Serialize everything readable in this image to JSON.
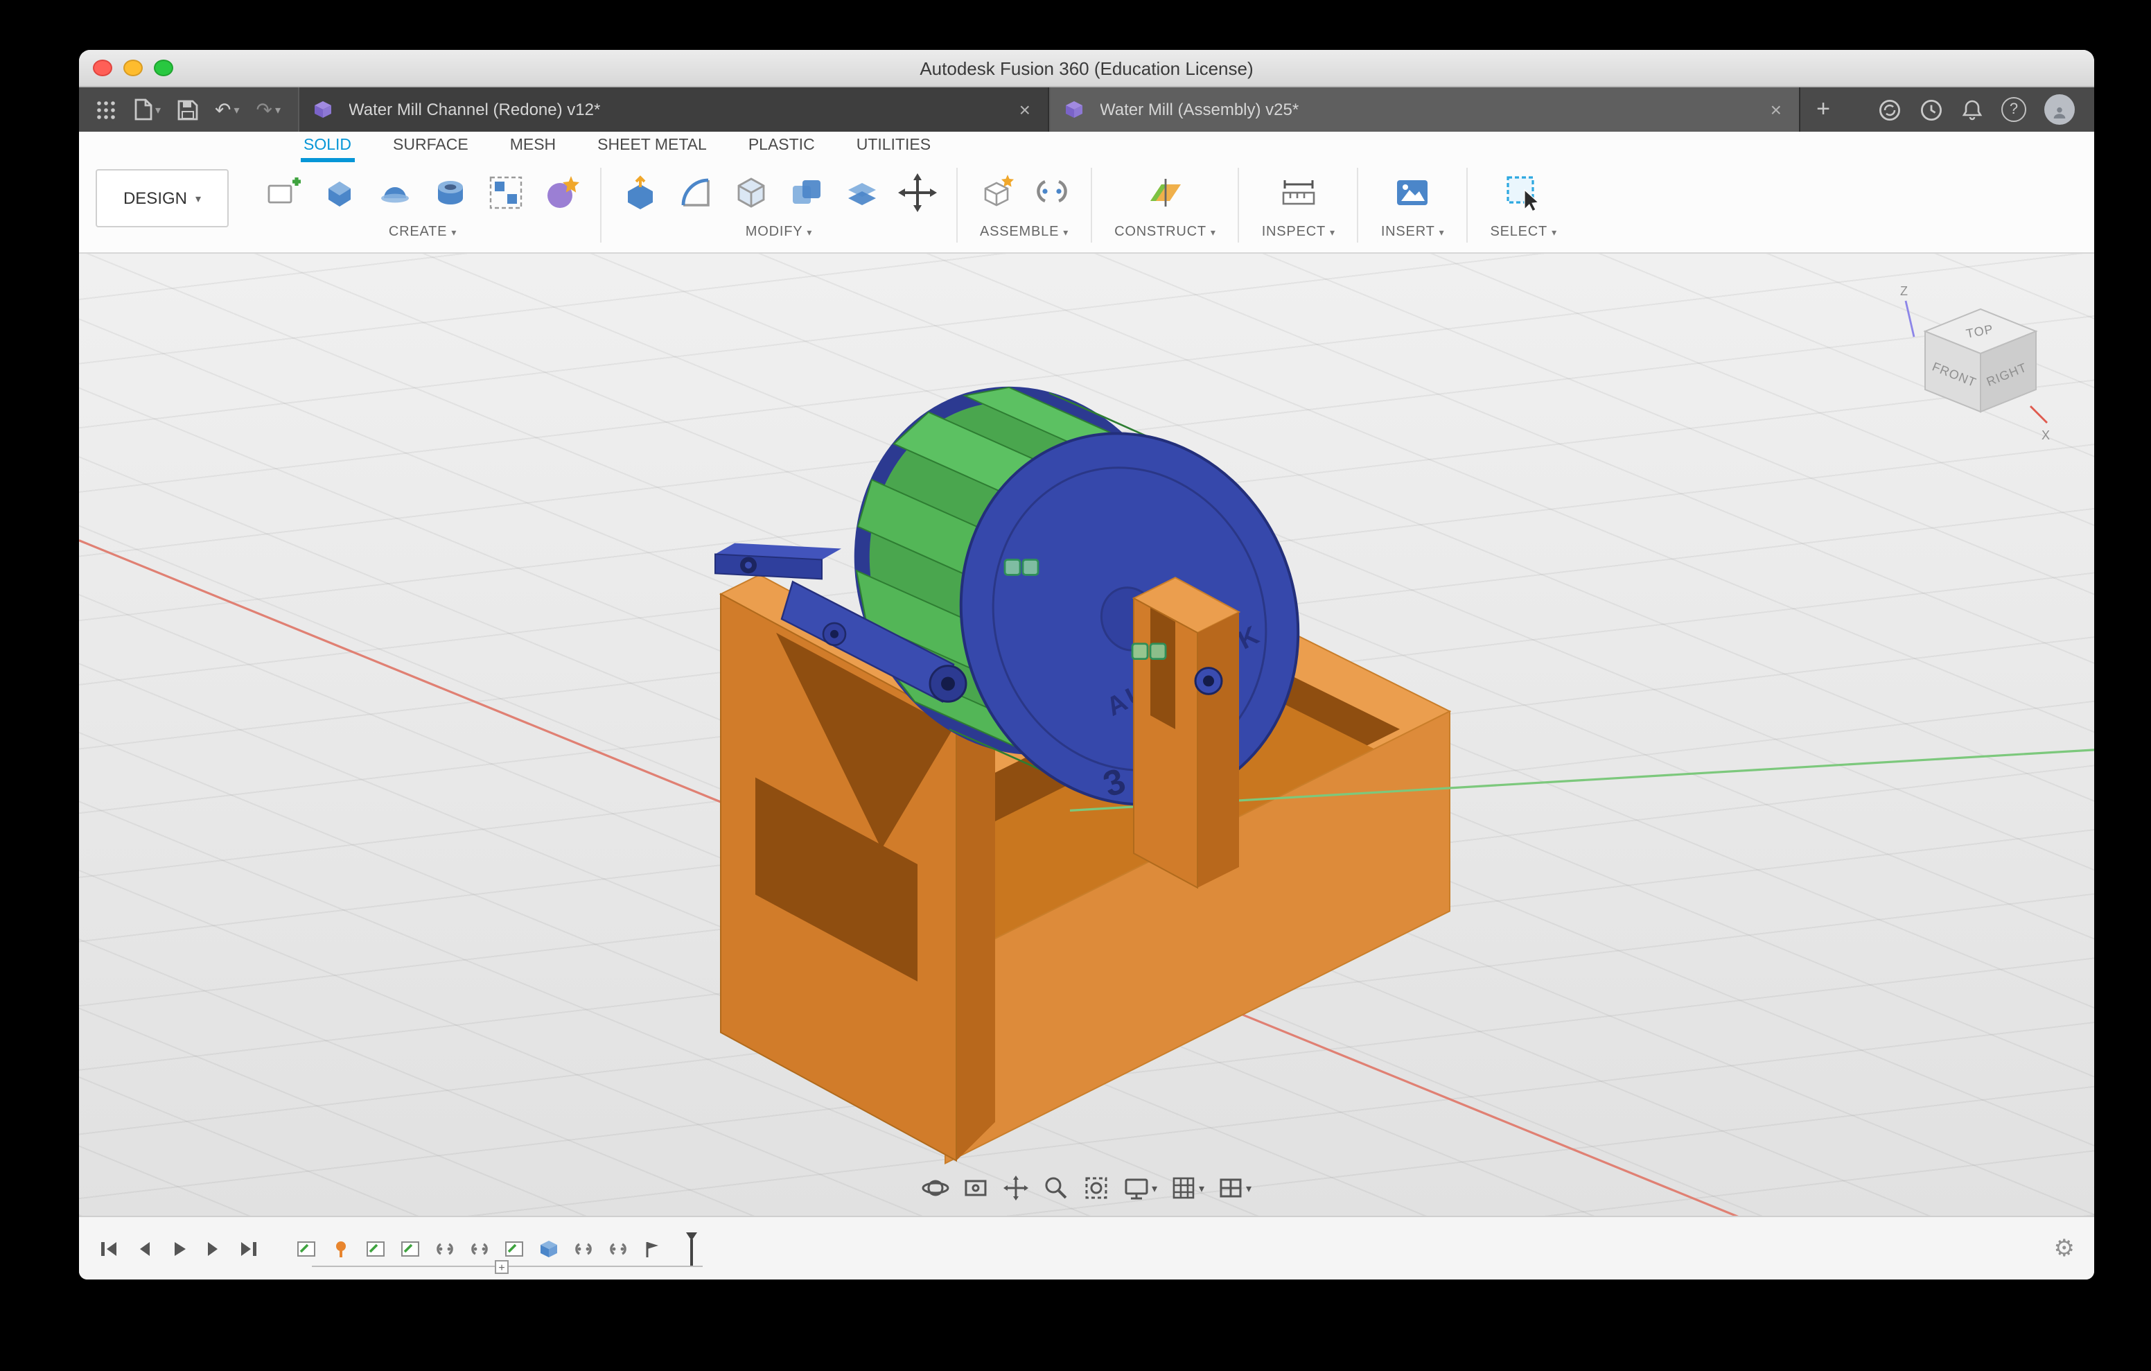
{
  "window": {
    "title": "Autodesk Fusion 360 (Education License)"
  },
  "ui": {
    "caret": "▾",
    "close": "×",
    "add": "+",
    "gear": "⚙",
    "undo": "↶",
    "redo": "↷",
    "help": "?"
  },
  "tabbar": {
    "tabs": [
      {
        "label": "Water Mill Channel (Redone) v12*",
        "active": false
      },
      {
        "label": "Water Mill (Assembly) v25*",
        "active": true
      }
    ],
    "left_icons": [
      "app-grid",
      "file-new",
      "save",
      "undo",
      "redo"
    ],
    "right_icons": [
      "sync-status",
      "recent",
      "notifications",
      "help",
      "account"
    ]
  },
  "ribbon": {
    "workspace": "DESIGN",
    "tabs": [
      {
        "label": "SOLID",
        "active": true
      },
      {
        "label": "SURFACE",
        "active": false
      },
      {
        "label": "MESH",
        "active": false
      },
      {
        "label": "SHEET METAL",
        "active": false
      },
      {
        "label": "PLASTIC",
        "active": false
      },
      {
        "label": "UTILITIES",
        "active": false
      }
    ],
    "groups": [
      {
        "label": "CREATE",
        "icons": [
          "create-sketch",
          "extrude",
          "revolve",
          "hole",
          "pattern",
          "create-form"
        ]
      },
      {
        "label": "MODIFY",
        "icons": [
          "press-pull",
          "fillet",
          "shell",
          "combine",
          "offset-face",
          "move"
        ]
      },
      {
        "label": "ASSEMBLE",
        "icons": [
          "new-component",
          "joint"
        ]
      },
      {
        "label": "CONSTRUCT",
        "icons": [
          "construction-plane"
        ]
      },
      {
        "label": "INSPECT",
        "icons": [
          "measure"
        ]
      },
      {
        "label": "INSERT",
        "icons": [
          "insert-canvas"
        ]
      },
      {
        "label": "SELECT",
        "icons": [
          "select-window"
        ]
      }
    ]
  },
  "viewport": {
    "viewcube": {
      "top": "TOP",
      "front": "FRONT",
      "right": "RIGHT",
      "axis_z": "Z",
      "axis_x": "X"
    },
    "model": {
      "brand": "AUTODESK",
      "digit": "3"
    },
    "nav_toolbar": [
      "orbit",
      "look-at",
      "pan",
      "zoom",
      "fit",
      "display-settings",
      "grid-display",
      "viewports"
    ],
    "colors": {
      "base_orange": "#dd8b3a",
      "wheel_blue": "#3648ab",
      "blade_green": "#53b657",
      "axis_red": "#e08073",
      "axis_green": "#7cc87c"
    }
  },
  "timeline": {
    "transport": [
      "go-to-start",
      "step-back",
      "play",
      "step-forward",
      "go-to-end"
    ],
    "features": [
      "sketch",
      "pin",
      "sketch",
      "sketch",
      "joint",
      "joint",
      "sketch",
      "component",
      "joint",
      "joint",
      "flag"
    ],
    "has_position_marker": true
  }
}
